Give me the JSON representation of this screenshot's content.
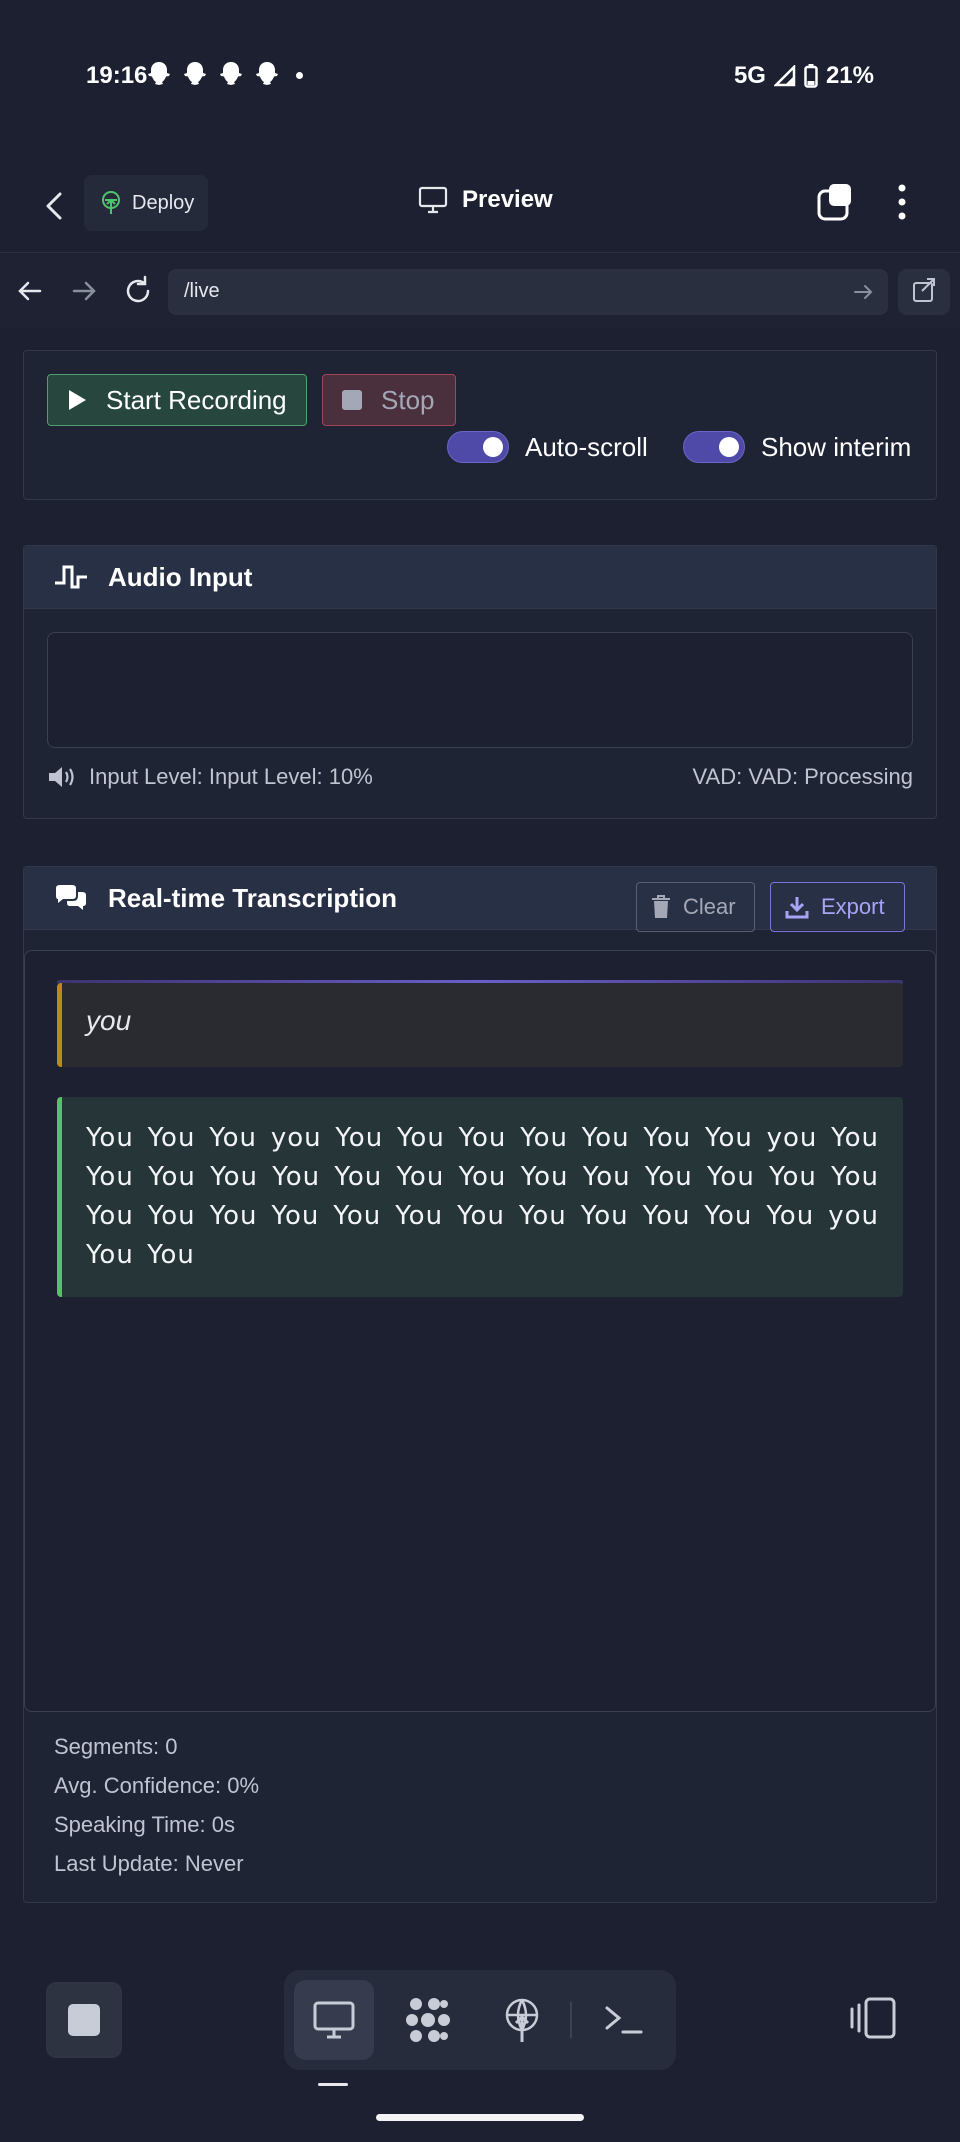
{
  "status_bar": {
    "time": "19:16",
    "network": "5G",
    "battery": "21%"
  },
  "app_header": {
    "deploy_label": "Deploy",
    "title": "Preview"
  },
  "browser": {
    "url": "/live"
  },
  "controls": {
    "start_label": "Start Recording",
    "stop_label": "Stop",
    "autoscroll_label": "Auto-scroll",
    "show_interim_label": "Show interim",
    "autoscroll_on": true,
    "show_interim_on": true
  },
  "audio_input": {
    "title": "Audio Input",
    "input_level": "Input Level: Input Level: 10%",
    "vad": "VAD: VAD: Processing"
  },
  "transcription": {
    "title": "Real-time Transcription",
    "clear_label": "Clear",
    "export_label": "Export",
    "interim_text": "you",
    "final_text": "You You You you You You You You You You You you You You You You You You You You You You You You You You You You You You You You You You You You You You you You You",
    "stats": {
      "segments": "Segments: 0",
      "avg_confidence": "Avg. Confidence: 0%",
      "speaking_time": "Speaking Time: 0s",
      "last_update": "Last Update: Never"
    }
  },
  "colors": {
    "background": "#1c2030",
    "accent": "#6a66c8",
    "success": "#4fa06d",
    "danger": "#a0475a",
    "interim_border": "#b98a1c",
    "final_border": "#4fc46b"
  }
}
